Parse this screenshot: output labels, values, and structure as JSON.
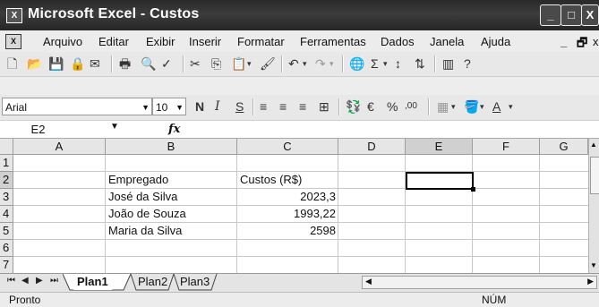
{
  "window": {
    "title": "Microsoft Excel - Custos",
    "app_icon": "X",
    "doc_icon": "X"
  },
  "menu": [
    "Arquivo",
    "Editar",
    "Exibir",
    "Inserir",
    "Formatar",
    "Ferramentas",
    "Dados",
    "Janela",
    "Ajuda"
  ],
  "formatting": {
    "font": "Arial",
    "size": "10"
  },
  "formula_bar": {
    "name_box": "E2",
    "fx": "fx",
    "content": ""
  },
  "columns": [
    "A",
    "B",
    "C",
    "D",
    "E",
    "F",
    "G"
  ],
  "rows": [
    "1",
    "2",
    "3",
    "4",
    "5",
    "6",
    "7"
  ],
  "cells": {
    "B2": "Empregado",
    "C2": "Custos (R$)",
    "B3": "José da Silva",
    "C3": "2023,3",
    "B4": "João de Souza",
    "C4": "1993,22",
    "B5": "Maria da Silva",
    "C5": "2598"
  },
  "sheets": [
    "Plan1",
    "Plan2",
    "Plan3"
  ],
  "active_sheet": "Plan1",
  "status": {
    "left": "Pronto",
    "mode": "NÚM"
  }
}
